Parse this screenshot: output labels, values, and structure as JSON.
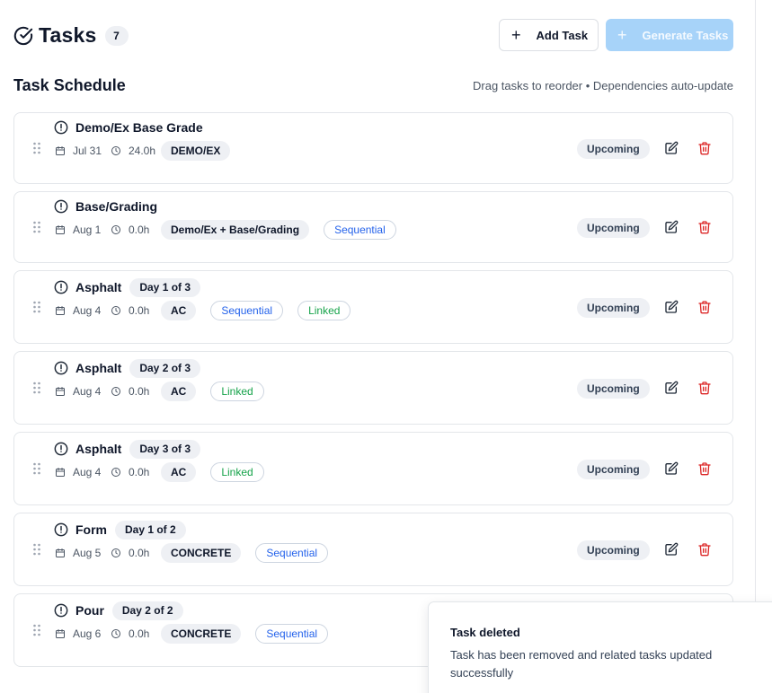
{
  "header": {
    "title": "Tasks",
    "count": "7",
    "add_task_label": "Add Task",
    "generate_tasks_label": "Generate Tasks"
  },
  "schedule": {
    "title": "Task Schedule",
    "hint": "Drag tasks to reorder • Dependencies auto-update"
  },
  "colors": {
    "accent_disabled": "#a7d3f9",
    "sequential": "#2563eb",
    "linked": "#16a34a",
    "delete": "#dc2626"
  },
  "tasks": [
    {
      "name": "Demo/Ex Base Grade",
      "day_label": "",
      "date": "Jul 31",
      "duration": "24.0h",
      "category": "DEMO/EX",
      "tags": [],
      "status": "Upcoming"
    },
    {
      "name": "Base/Grading",
      "day_label": "",
      "date": "Aug 1",
      "duration": "0.0h",
      "category": "Demo/Ex + Base/Grading",
      "tags": [
        "Sequential"
      ],
      "status": "Upcoming"
    },
    {
      "name": "Asphalt",
      "day_label": "Day 1 of 3",
      "date": "Aug 4",
      "duration": "0.0h",
      "category": "AC",
      "tags": [
        "Sequential",
        "Linked"
      ],
      "status": "Upcoming"
    },
    {
      "name": "Asphalt",
      "day_label": "Day 2 of 3",
      "date": "Aug 4",
      "duration": "0.0h",
      "category": "AC",
      "tags": [
        "Linked"
      ],
      "status": "Upcoming"
    },
    {
      "name": "Asphalt",
      "day_label": "Day 3 of 3",
      "date": "Aug 4",
      "duration": "0.0h",
      "category": "AC",
      "tags": [
        "Linked"
      ],
      "status": "Upcoming"
    },
    {
      "name": "Form",
      "day_label": "Day 1 of 2",
      "date": "Aug 5",
      "duration": "0.0h",
      "category": "CONCRETE",
      "tags": [
        "Sequential"
      ],
      "status": "Upcoming"
    },
    {
      "name": "Pour",
      "day_label": "Day 2 of 2",
      "date": "Aug 6",
      "duration": "0.0h",
      "category": "CONCRETE",
      "tags": [
        "Sequential"
      ],
      "status": ""
    }
  ],
  "toast": {
    "title": "Task deleted",
    "description": "Task has been removed and related tasks updated successfully"
  },
  "icons": {
    "title": "check-circle-icon",
    "drag": "grip-vertical-icon",
    "task_status": "alert-circle-icon",
    "date": "calendar-icon",
    "duration": "clock-icon",
    "edit": "edit-icon",
    "delete": "trash-icon"
  }
}
